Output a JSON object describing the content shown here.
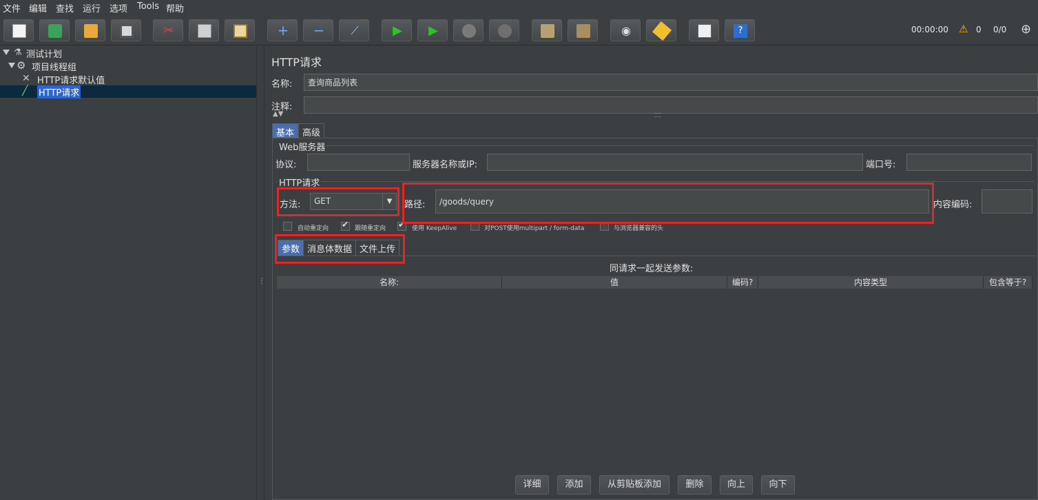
{
  "menu": {
    "file": "文件",
    "edit": "编辑",
    "search": "查找",
    "run": "运行",
    "options": "选项",
    "tools": "Tools",
    "help": "帮助"
  },
  "toolbar": {
    "buttons": [
      "new-icon",
      "templates-icon",
      "open-icon",
      "save-icon",
      "cut-icon",
      "copy-icon",
      "paste-icon",
      "expand-icon",
      "collapse-icon",
      "toggle-icon",
      "start-icon",
      "start-no-pause-icon",
      "stop-icon",
      "shutdown-icon",
      "clear-icon",
      "clear-all-icon",
      "search-icon",
      "reset-search-icon",
      "function-helper-icon",
      "help-icon"
    ],
    "elapsed_time": "00:00:00",
    "warning_count": "0",
    "threads": "0/0"
  },
  "tree": {
    "test_plan": "测试计划",
    "thread_group": "项目线程组",
    "http_defaults": "HTTP请求默认值",
    "http_request": "HTTP请求"
  },
  "panel": {
    "title": "HTTP请求",
    "name_label": "名称:",
    "name_value": "查询商品列表",
    "comment_label": "注释:",
    "tabs": {
      "basic": "基本",
      "advanced": "高级"
    },
    "web_server": {
      "section": "Web服务器",
      "protocol_label": "协议:",
      "server_label": "服务器名称或IP:",
      "port_label": "端口号:"
    },
    "http_request": {
      "section": "HTTP请求",
      "method_label": "方法:",
      "method_value": "GET",
      "path_label": "路径:",
      "path_value": "/goods/query",
      "encoding_label": "内容编码:"
    },
    "options": [
      {
        "label": "自动重定向",
        "checked": false
      },
      {
        "label": "跟随重定向",
        "checked": true
      },
      {
        "label": "使用 KeepAlive",
        "checked": true
      },
      {
        "label": "对POST使用multipart / form-data",
        "checked": false
      },
      {
        "label": "与浏览器兼容的头",
        "checked": false
      }
    ],
    "sub_tabs": {
      "params": "参数",
      "body": "消息体数据",
      "files": "文件上传"
    },
    "params_title": "同请求一起发送参数:",
    "columns": {
      "name": "名称:",
      "value": "值",
      "encode": "编码?",
      "content_type": "内容类型",
      "include_equals": "包含等于?"
    },
    "buttons": {
      "detail": "详细",
      "add": "添加",
      "add_clipboard": "从剪贴板添加",
      "delete": "删除",
      "up": "向上",
      "down": "向下"
    }
  },
  "colors": {
    "background": "#3c3f41",
    "selection": "#2f65ca",
    "highlight": "#e0282a"
  }
}
